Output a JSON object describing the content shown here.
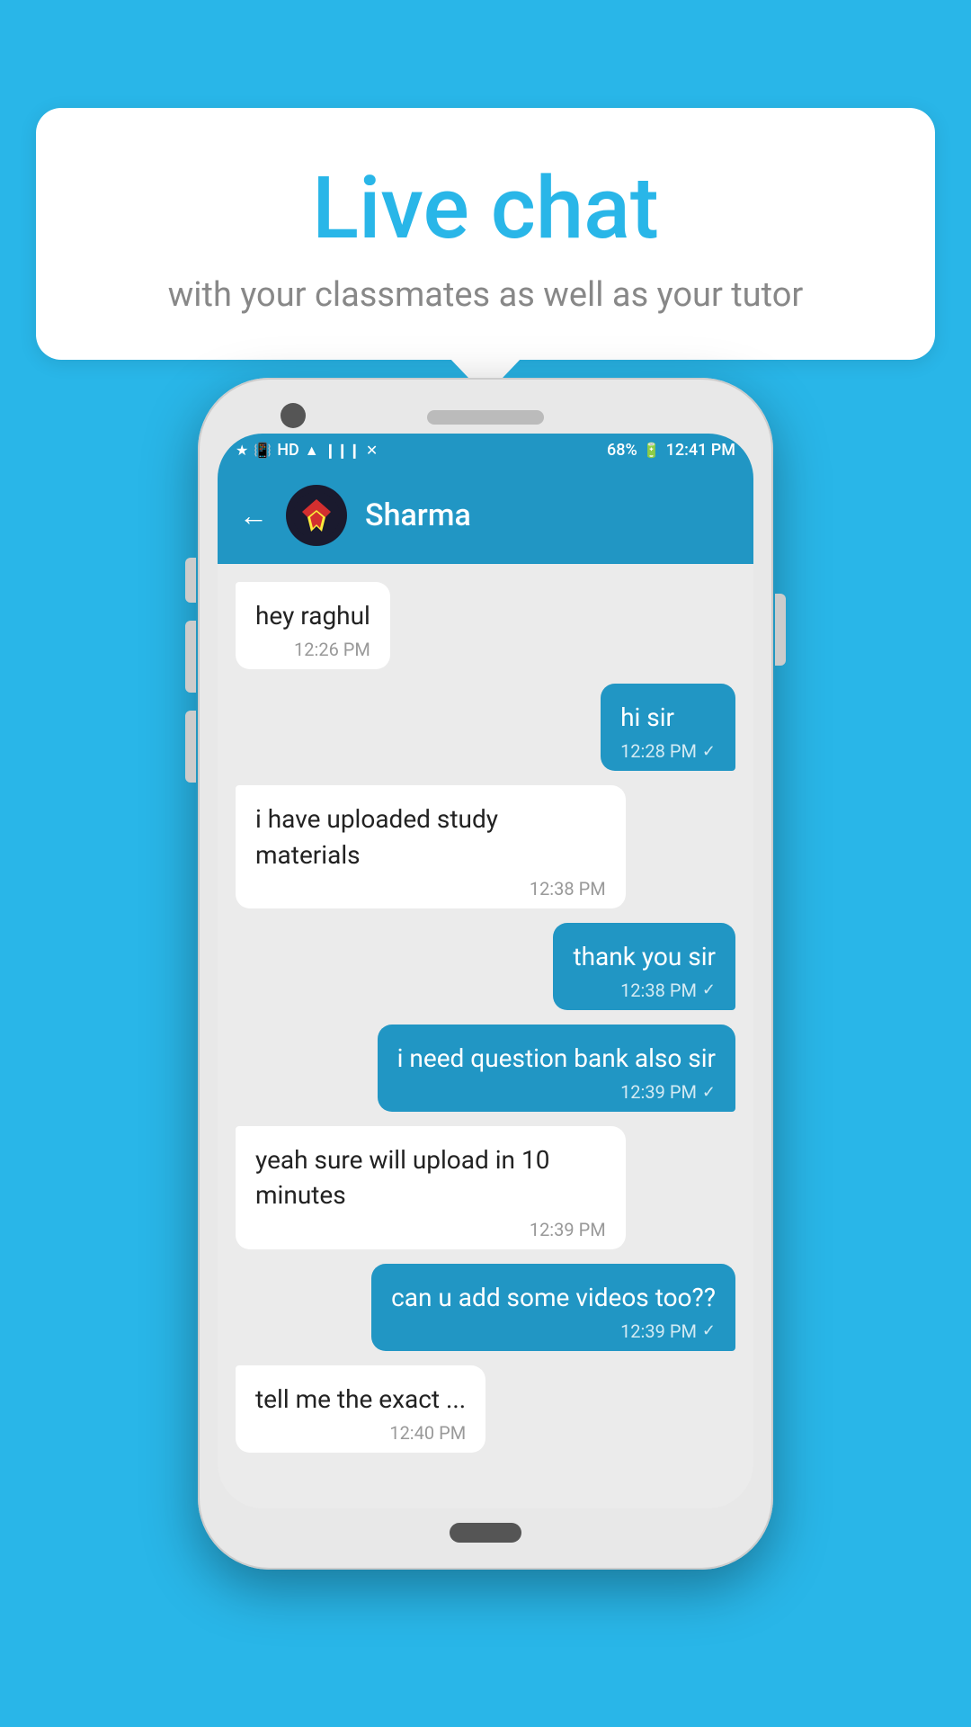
{
  "background_color": "#29B6E8",
  "bubble": {
    "title": "Live chat",
    "subtitle": "with your classmates as well as your tutor"
  },
  "phone": {
    "status_bar": {
      "time": "12:41 PM",
      "battery": "68%",
      "icons": [
        "bluetooth",
        "vibrate",
        "hd",
        "wifi",
        "signal",
        "signal-x",
        "battery"
      ]
    },
    "app_bar": {
      "contact_name": "Sharma",
      "back_label": "←"
    },
    "messages": [
      {
        "id": "msg1",
        "type": "received",
        "text": "hey raghul",
        "time": "12:26 PM",
        "check": false
      },
      {
        "id": "msg2",
        "type": "sent",
        "text": "hi sir",
        "time": "12:28 PM",
        "check": true
      },
      {
        "id": "msg3",
        "type": "received",
        "text": "i have uploaded study materials",
        "time": "12:38 PM",
        "check": false
      },
      {
        "id": "msg4",
        "type": "sent",
        "text": "thank you sir",
        "time": "12:38 PM",
        "check": true
      },
      {
        "id": "msg5",
        "type": "sent",
        "text": "i need question bank also sir",
        "time": "12:39 PM",
        "check": true
      },
      {
        "id": "msg6",
        "type": "received",
        "text": "yeah sure will upload in 10 minutes",
        "time": "12:39 PM",
        "check": false
      },
      {
        "id": "msg7",
        "type": "sent",
        "text": "can u add some videos too??",
        "time": "12:39 PM",
        "check": true
      },
      {
        "id": "msg8",
        "type": "received",
        "text": "tell me the exact topic",
        "time": "12:40 PM",
        "check": false,
        "partial": true
      }
    ]
  }
}
